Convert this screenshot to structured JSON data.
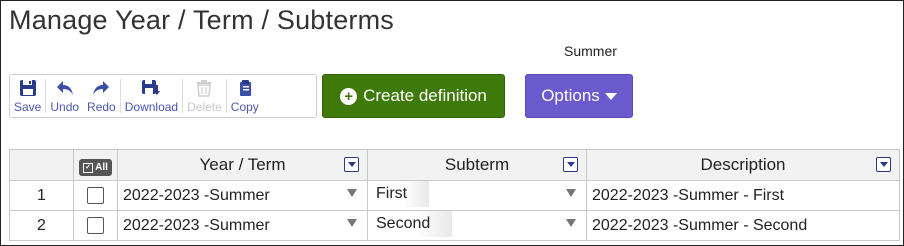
{
  "page": {
    "title": "Manage Year / Term / Subterms",
    "subtitle": "Summer"
  },
  "toolbar": {
    "save": "Save",
    "undo": "Undo",
    "redo": "Redo",
    "download": "Download",
    "delete": "Delete",
    "copy": "Copy"
  },
  "actions": {
    "create": "Create definition",
    "options": "Options"
  },
  "table": {
    "all_label": "All",
    "headers": {
      "year_term": "Year / Term",
      "subterm": "Subterm",
      "description": "Description"
    },
    "rows": [
      {
        "num": "1",
        "year_term": "2022-2023 -Summer",
        "subterm": "First",
        "description": "2022-2023 -Summer - First"
      },
      {
        "num": "2",
        "year_term": "2022-2023 -Summer",
        "subterm": "Second",
        "description": "2022-2023 -Summer - Second"
      }
    ]
  },
  "colors": {
    "create_button": "#3d7a0a",
    "options_button": "#6a5acd",
    "toolbar_text": "#4a56b0"
  }
}
